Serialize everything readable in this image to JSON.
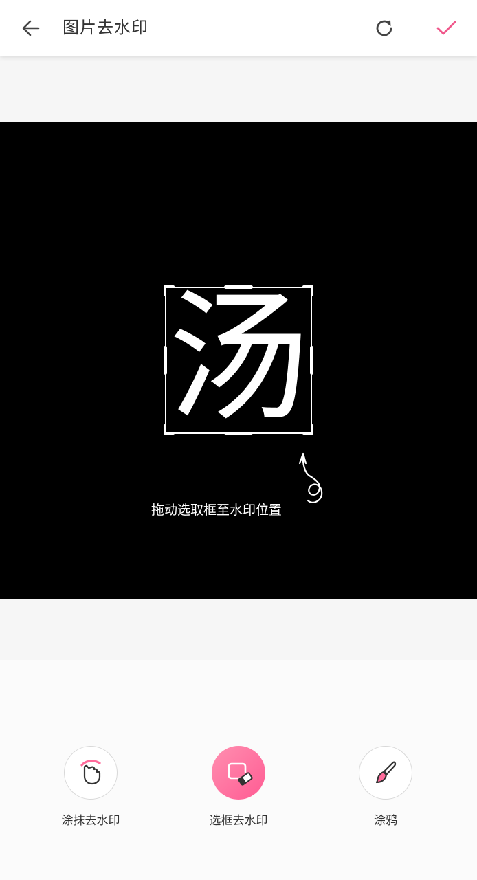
{
  "header": {
    "title": "图片去水印"
  },
  "icons": {
    "back": "arrow-left-icon",
    "reset": "refresh-icon",
    "confirm": "check-icon"
  },
  "colors": {
    "accent": "#ff5b93",
    "canvas_bg": "#000000",
    "text_primary": "#333333"
  },
  "canvas": {
    "watermark_text": "汤",
    "hint": "拖动选取框至水印位置"
  },
  "tools": [
    {
      "label": "涂抹去水印",
      "icon": "hand-smear-icon",
      "active": false
    },
    {
      "label": "选框去水印",
      "icon": "frame-eraser-icon",
      "active": true
    },
    {
      "label": "涂鸦",
      "icon": "brush-icon",
      "active": false
    }
  ]
}
